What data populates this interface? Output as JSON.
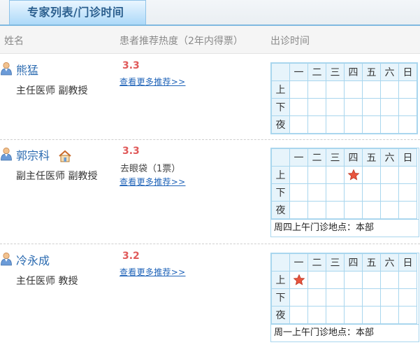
{
  "tab": {
    "label": "专家列表/门诊时间"
  },
  "columns": {
    "name": "姓名",
    "rating": "患者推荐热度（2年内得票）",
    "schedule": "出诊时间"
  },
  "schedule_header": {
    "days": [
      "一",
      "二",
      "三",
      "四",
      "五",
      "六",
      "日"
    ],
    "periods": [
      "上",
      "下",
      "夜"
    ]
  },
  "colors": {
    "accent": "#2a6ab0",
    "score": "#e05a5a",
    "grid": "#a9d6ee",
    "tab": "#a9d7f8",
    "star": "#e8553e"
  },
  "doctors": [
    {
      "name": "熊猛",
      "title": "主任医师  副教授",
      "score": "3.3",
      "vote": "",
      "more_link": "查看更多推荐>>",
      "note": "",
      "has_house": false,
      "slots": []
    },
    {
      "name": "郭宗科",
      "title": "副主任医师  副教授",
      "score": "3.3",
      "vote": "去眼袋（1票）",
      "more_link": "查看更多推荐>>",
      "note": "周四上午门诊地点：本部",
      "has_house": true,
      "slots": [
        {
          "period": 0,
          "day": 3
        }
      ]
    },
    {
      "name": "冷永成",
      "title": "主任医师  教授",
      "score": "3.2",
      "vote": "",
      "more_link": "查看更多推荐>>",
      "note": "周一上午门诊地点：本部",
      "has_house": false,
      "slots": [
        {
          "period": 0,
          "day": 0
        }
      ]
    }
  ]
}
